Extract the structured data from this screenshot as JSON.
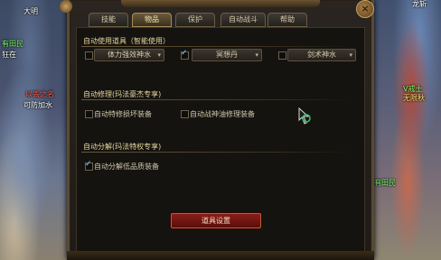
{
  "window": {
    "title": ""
  },
  "tabs": [
    {
      "label": "技能",
      "active": false
    },
    {
      "label": "物品",
      "active": true
    },
    {
      "label": "保护",
      "active": false
    },
    {
      "label": "自动战斗",
      "active": false
    },
    {
      "label": "帮助",
      "active": false
    }
  ],
  "auto_item": {
    "title": "自动使用道具（智能使用）",
    "options": [
      {
        "label": "体力强效神水",
        "checked": false
      },
      {
        "label": "冥想丹",
        "checked": true
      },
      {
        "label": "剑术神水",
        "checked": false
      }
    ]
  },
  "auto_repair": {
    "title": "自动修理(玛法豪杰专享)",
    "options": [
      {
        "label": "自动特修损坏装备",
        "checked": false
      },
      {
        "label": "自动战神油修理装备",
        "checked": false
      }
    ]
  },
  "auto_decompose": {
    "title": "自动分解(玛法特权专享)",
    "options": [
      {
        "label": "自动分解低品质装备",
        "checked": true
      }
    ]
  },
  "footer": {
    "button_label": "道具设置"
  },
  "background": {
    "left_texts": [
      "大明",
      "有田民",
      "狂在",
      "以丢之名",
      "可防加水"
    ],
    "right_texts": [
      "龙斩",
      "V戒士",
      "无限秋",
      "有田民"
    ]
  },
  "colors": {
    "accent": "#e8d6a0",
    "button_red": "#8a1e17",
    "check_blue": "#7fd0ff"
  }
}
